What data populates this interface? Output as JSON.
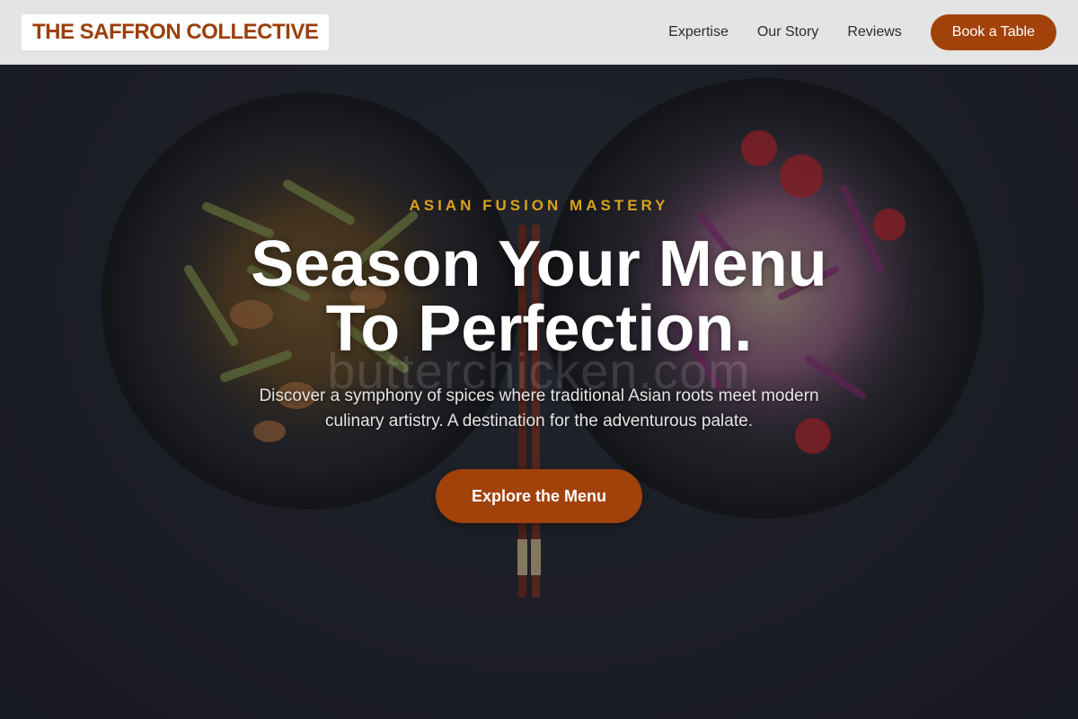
{
  "header": {
    "logo_text": "THE SAFFRON COLLECTIVE",
    "nav": [
      {
        "label": "Expertise"
      },
      {
        "label": "Our Story"
      },
      {
        "label": "Reviews"
      }
    ],
    "book_label": "Book a Table"
  },
  "hero": {
    "eyebrow": "ASIAN FUSION MASTERY",
    "headline_line1": "Season Your Menu",
    "headline_line2": "To Perfection.",
    "subhead": "Discover a symphony of spices where traditional Asian roots meet modern culinary artistry. A destination for the adventurous palate.",
    "cta_label": "Explore the Menu",
    "watermark": "butterchicken.com"
  },
  "colors": {
    "brand": "#a1420b",
    "logo_text": "#9a3f0a",
    "eyebrow": "#d9a21c",
    "header_bg": "#ececec"
  },
  "background_image": "two-dark-bowls-stir-fry-and-salad-with-chopsticks"
}
